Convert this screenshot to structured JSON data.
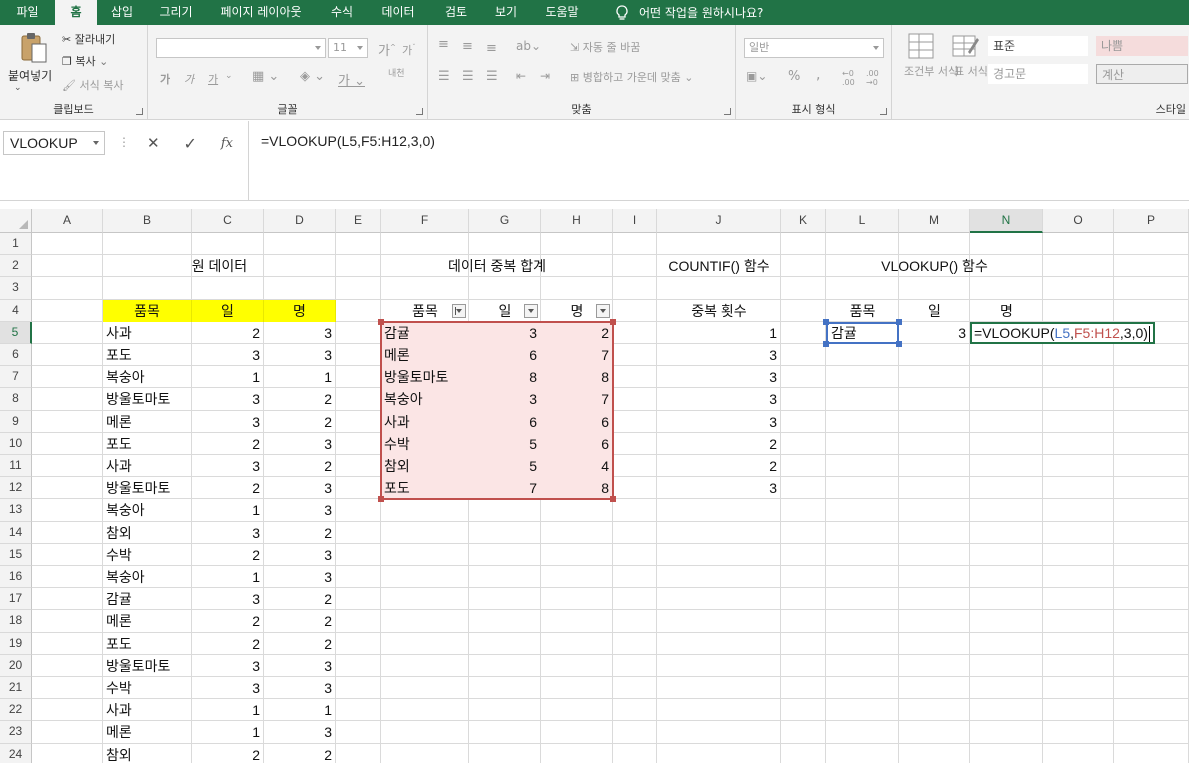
{
  "menu": {
    "tabs": [
      "파일",
      "홈",
      "삽입",
      "그리기",
      "페이지 레이아웃",
      "수식",
      "데이터",
      "검토",
      "보기",
      "도움말"
    ],
    "tell_me": "어떤 작업을 원하시나요?"
  },
  "ribbon": {
    "clipboard": {
      "label": "클립보드",
      "paste": "붙여넣기",
      "cut": "잘라내기",
      "copy": "복사",
      "format_painter": "서식 복사"
    },
    "font": {
      "label": "글꼴",
      "size": "11",
      "bold": "가",
      "italic": "가",
      "underline": "가",
      "phonetic": "내천"
    },
    "alignment": {
      "label": "맞춤",
      "wrap": "자동 줄 바꿈",
      "merge": "병합하고 가운데 맞춤"
    },
    "number": {
      "label": "표시 형식",
      "format": "일반",
      "percent": "%",
      "comma": ","
    },
    "styles": {
      "label": "스타일",
      "conditional": "조건부 서식",
      "table": "표 서식",
      "cells": [
        "표준",
        "나쁨",
        "경고문",
        "계산"
      ]
    }
  },
  "formula_bar": {
    "name_box": "VLOOKUP",
    "cancel": "✕",
    "enter": "✓",
    "fx": "fx",
    "formula": "=VLOOKUP(L5,F5:H12,3,0)"
  },
  "sheet": {
    "columns": [
      "A",
      "B",
      "C",
      "D",
      "E",
      "F",
      "G",
      "H",
      "I",
      "J",
      "K",
      "L",
      "M",
      "N",
      "O",
      "P"
    ],
    "rows": [
      "1",
      "2",
      "3",
      "4",
      "5",
      "6",
      "7",
      "8",
      "9",
      "10",
      "11",
      "12",
      "13",
      "14",
      "15",
      "16",
      "17",
      "18",
      "19",
      "20",
      "21",
      "22",
      "23",
      "24"
    ],
    "titles": {
      "source": "원 데이터",
      "summary": "데이터 중복 합계",
      "countif": "COUNTIF() 함수",
      "vlookup": "VLOOKUP() 함수"
    },
    "source": {
      "headers": [
        "품목",
        "일",
        "명"
      ],
      "rows": [
        [
          "사과",
          "2",
          "3"
        ],
        [
          "포도",
          "3",
          "3"
        ],
        [
          "복숭아",
          "1",
          "1"
        ],
        [
          "방울토마토",
          "3",
          "2"
        ],
        [
          "메론",
          "3",
          "2"
        ],
        [
          "포도",
          "2",
          "3"
        ],
        [
          "사과",
          "3",
          "2"
        ],
        [
          "방울토마토",
          "2",
          "3"
        ],
        [
          "복숭아",
          "1",
          "3"
        ],
        [
          "참외",
          "3",
          "2"
        ],
        [
          "수박",
          "2",
          "3"
        ],
        [
          "복숭아",
          "1",
          "3"
        ],
        [
          "감귤",
          "3",
          "2"
        ],
        [
          "메론",
          "2",
          "2"
        ],
        [
          "포도",
          "2",
          "2"
        ],
        [
          "방울토마토",
          "3",
          "3"
        ],
        [
          "수박",
          "3",
          "3"
        ],
        [
          "사과",
          "1",
          "1"
        ],
        [
          "메론",
          "1",
          "3"
        ],
        [
          "참외",
          "2",
          "2"
        ]
      ]
    },
    "summary": {
      "headers": [
        "품목",
        "일",
        "명"
      ],
      "rows": [
        [
          "감귤",
          "3",
          "2"
        ],
        [
          "메론",
          "6",
          "7"
        ],
        [
          "방울토마토",
          "8",
          "8"
        ],
        [
          "복숭아",
          "3",
          "7"
        ],
        [
          "사과",
          "6",
          "6"
        ],
        [
          "수박",
          "5",
          "6"
        ],
        [
          "참외",
          "5",
          "4"
        ],
        [
          "포도",
          "7",
          "8"
        ]
      ]
    },
    "countif": {
      "header": "중복 횟수",
      "values": [
        "1",
        "3",
        "3",
        "3",
        "3",
        "2",
        "2",
        "3"
      ]
    },
    "lookup": {
      "headers": [
        "품목",
        "일",
        "명"
      ],
      "item": "감귤",
      "day": "3",
      "edit": {
        "prefix": "=VLOOKUP(",
        "ref1": "L5",
        "comma1": ",",
        "ref2": "F5:H12",
        "suffix": ",3,0)"
      }
    }
  },
  "colors": {
    "ribbon_green": "#217346",
    "header_yellow": "#ffff00",
    "table_pink": "#fbe5e5",
    "table_border": "#c0504d",
    "ref_blue": "#4472c4",
    "ref_red": "#c0504d"
  }
}
